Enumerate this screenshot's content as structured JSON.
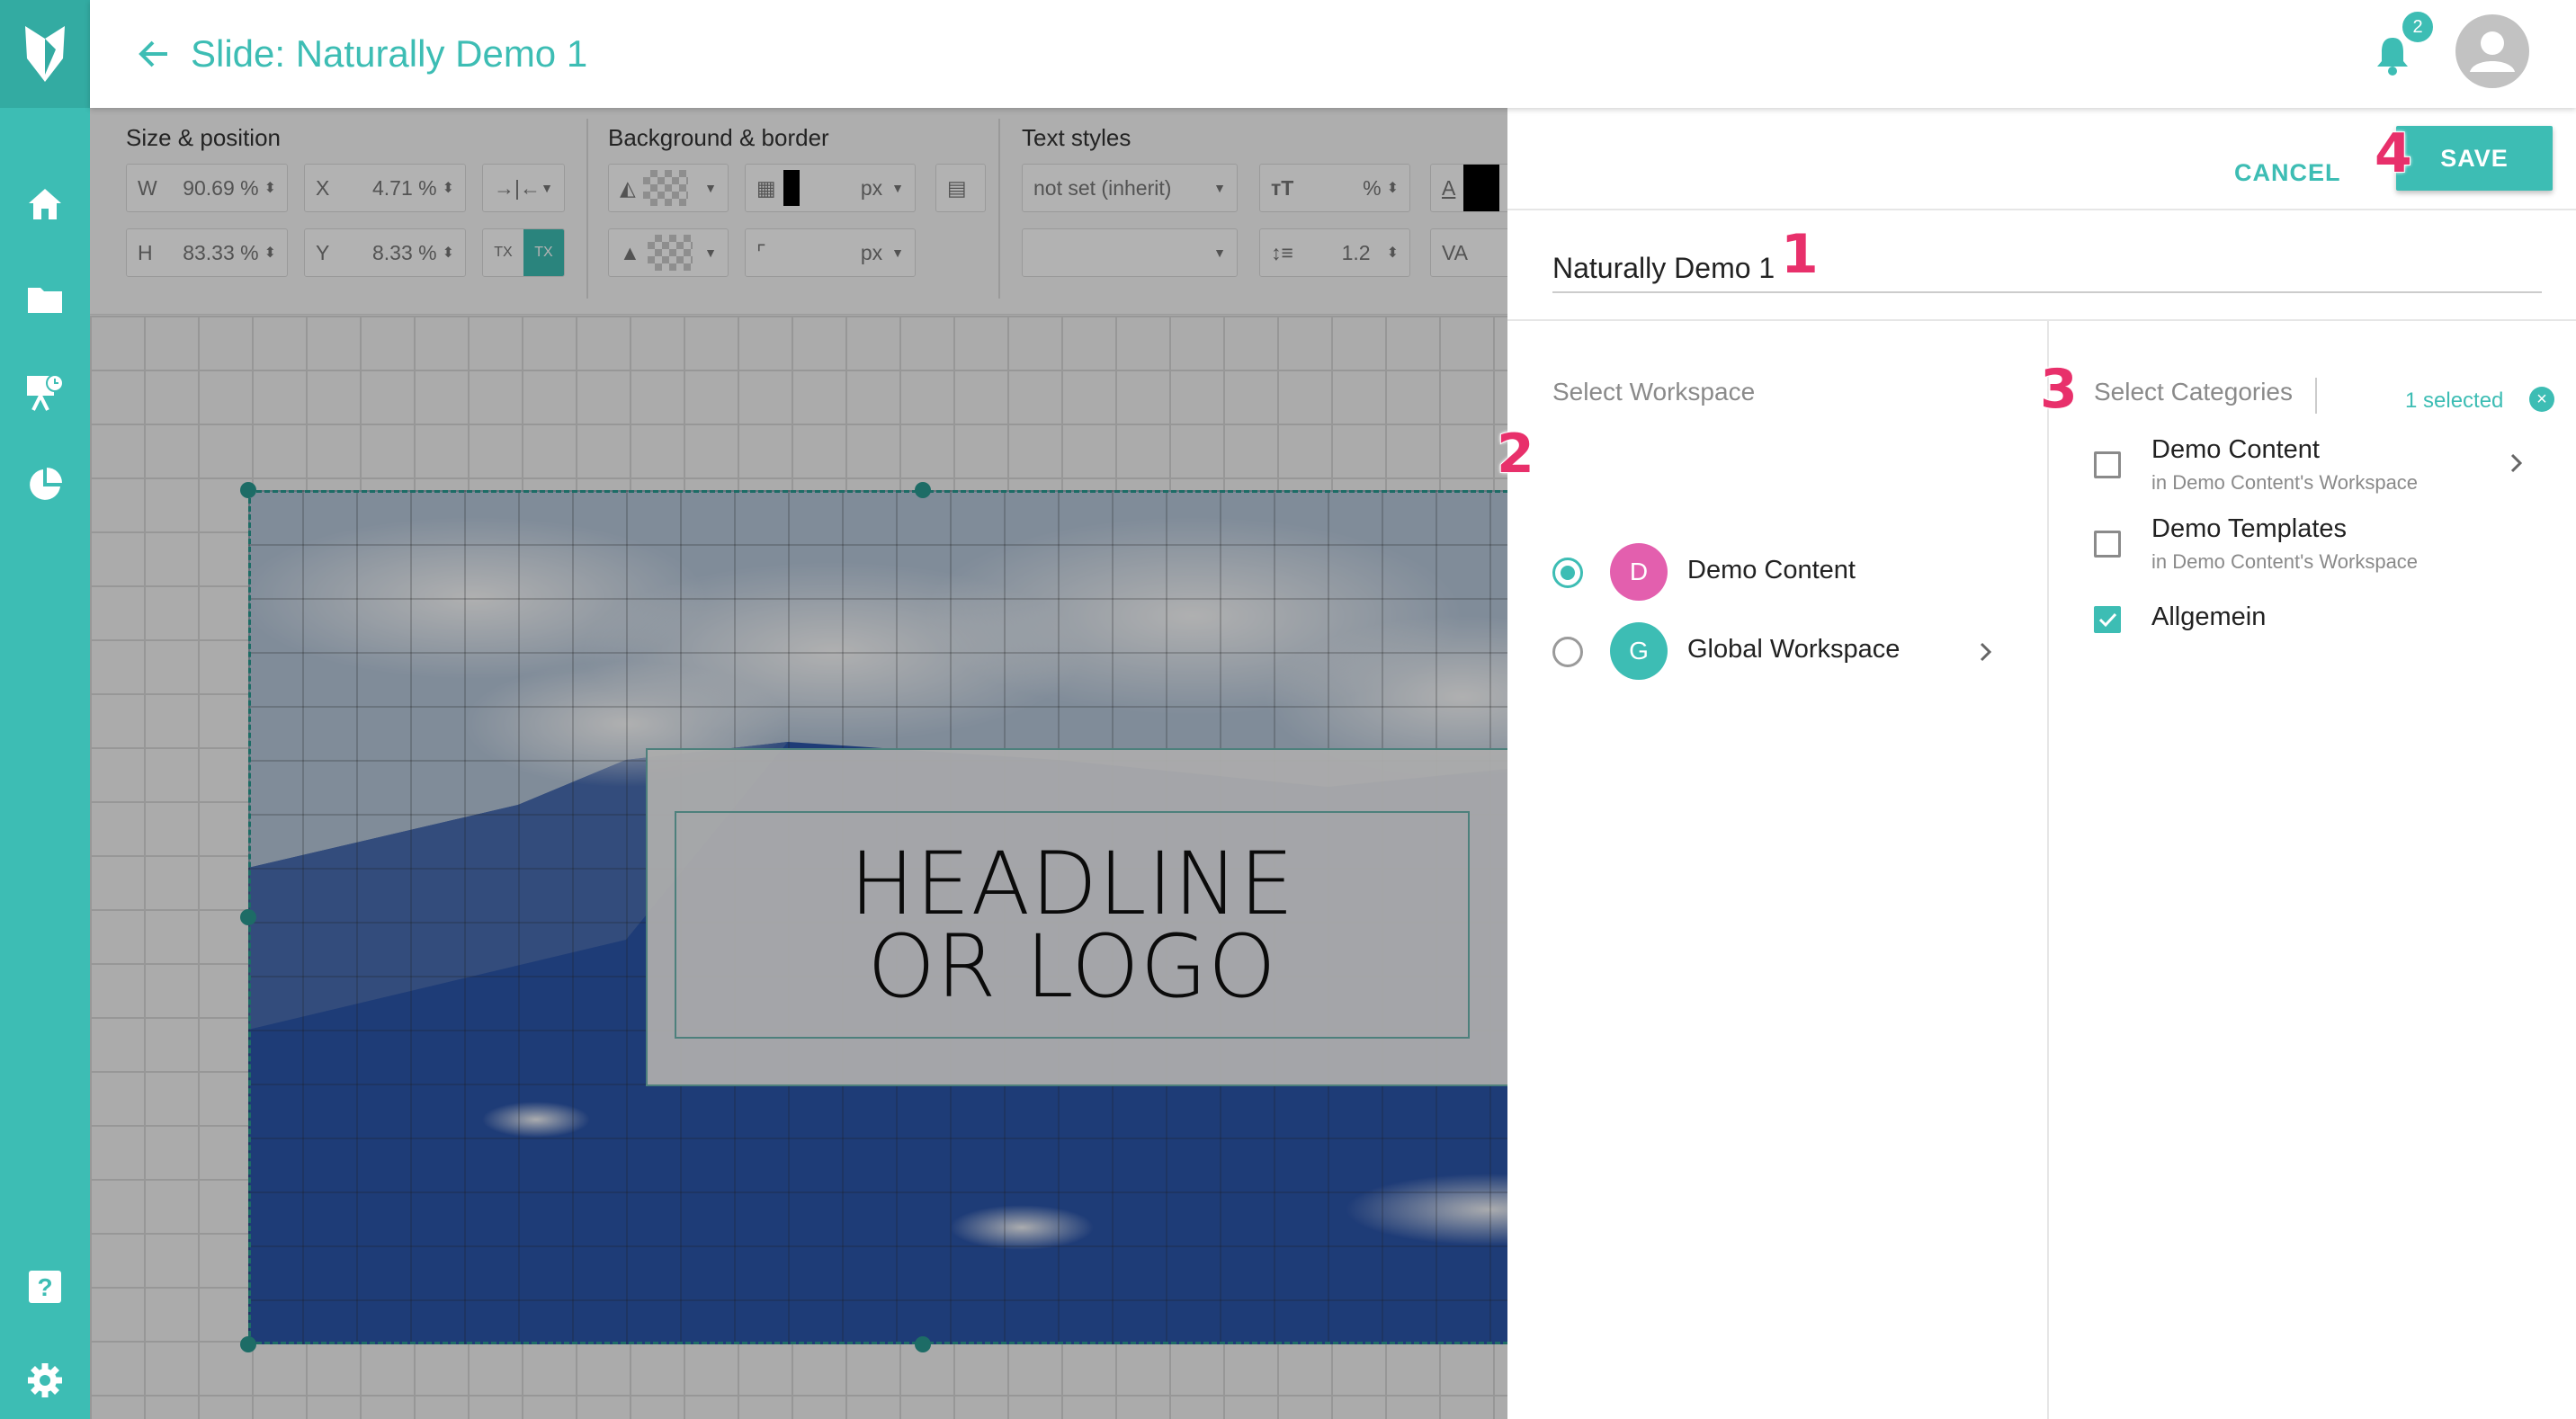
{
  "header": {
    "title": "Slide: Naturally Demo 1",
    "notification_count": "2"
  },
  "toolbar": {
    "size_position": {
      "title": "Size & position",
      "w_label": "W",
      "w_value": "90.69 %",
      "h_label": "H",
      "h_value": "83.33 %",
      "x_label": "X",
      "x_value": "4.71 %",
      "y_label": "Y",
      "y_value": "8.33 %"
    },
    "background_border": {
      "title": "Background & border",
      "border_unit": "px",
      "radius_unit": "px"
    },
    "text_styles": {
      "title": "Text styles",
      "font_value": "not set (inherit)",
      "size_unit": "%",
      "line_height": "1.2"
    }
  },
  "slide": {
    "headline": "HEADLINE OR LOGO"
  },
  "panel": {
    "cancel_label": "CANCEL",
    "save_label": "SAVE",
    "name_value": "Naturally Demo 1",
    "workspace": {
      "title": "Select Workspace",
      "items": [
        {
          "initial": "D",
          "label": "Demo Content",
          "selected": true,
          "color": "#e35fae"
        },
        {
          "initial": "G",
          "label": "Global Workspace",
          "selected": false,
          "color": "#3dbdb4"
        }
      ]
    },
    "categories": {
      "title": "Select Categories",
      "selected_count": "1 selected",
      "items": [
        {
          "label": "Demo Content",
          "sub": "in Demo Content's Workspace",
          "checked": false
        },
        {
          "label": "Demo Templates",
          "sub": "in Demo Content's Workspace",
          "checked": false
        },
        {
          "label": "Allgemein",
          "sub": "",
          "checked": true
        }
      ]
    }
  },
  "callouts": [
    "1",
    "2",
    "3",
    "4"
  ],
  "colors": {
    "accent": "#3dbdb4",
    "callout": "#e8306b"
  }
}
